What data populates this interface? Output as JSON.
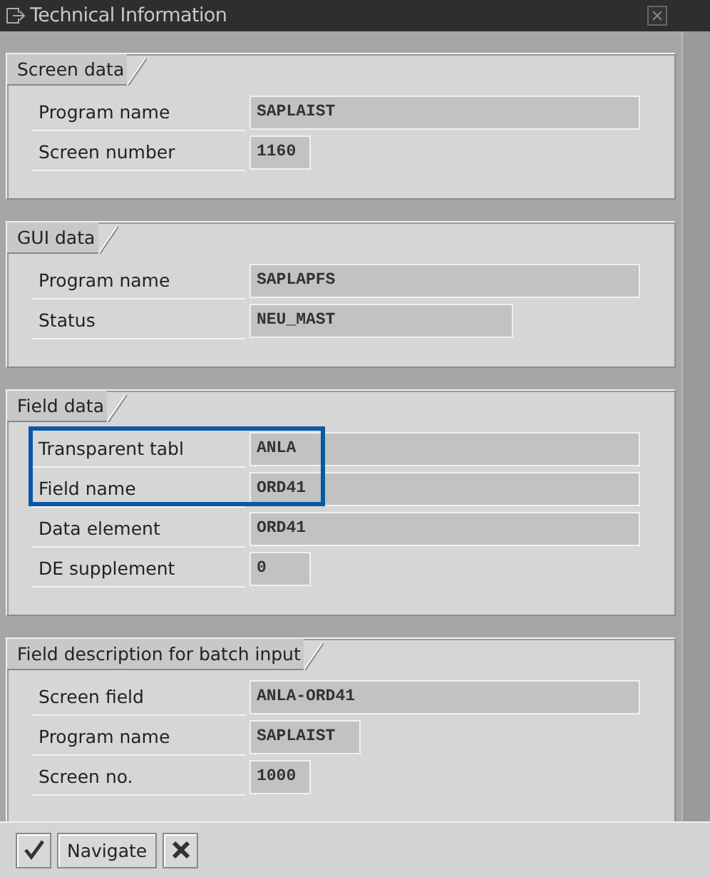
{
  "window": {
    "title": "Technical Information"
  },
  "groups": [
    {
      "title": "Screen data",
      "rows": [
        {
          "label": "Program name",
          "value": "SAPLAIST",
          "highlighted": false
        },
        {
          "label": "Screen number",
          "value": "1160",
          "highlighted": false
        }
      ]
    },
    {
      "title": "GUI data",
      "rows": [
        {
          "label": "Program name",
          "value": "SAPLAPFS",
          "highlighted": false
        },
        {
          "label": "Status",
          "value": "NEU_MAST",
          "highlighted": false
        }
      ]
    },
    {
      "title": "Field data",
      "rows": [
        {
          "label": "Transparent tabl",
          "value": "ANLA",
          "highlighted": true
        },
        {
          "label": "Field name",
          "value": "ORD41",
          "highlighted": true
        },
        {
          "label": "Data element",
          "value": "ORD41",
          "highlighted": false
        },
        {
          "label": "DE supplement",
          "value": "0",
          "highlighted": false
        }
      ]
    },
    {
      "title": "Field description for batch input",
      "rows": [
        {
          "label": "Screen field",
          "value": "ANLA-ORD41",
          "highlighted": false
        },
        {
          "label": "Program name",
          "value": "SAPLAIST",
          "highlighted": false
        },
        {
          "label": "Screen no.",
          "value": "1000",
          "highlighted": false
        }
      ]
    }
  ],
  "buttons": [
    {
      "kind": "confirm"
    },
    {
      "kind": "text",
      "label": "Navigate"
    },
    {
      "kind": "cancel"
    }
  ]
}
